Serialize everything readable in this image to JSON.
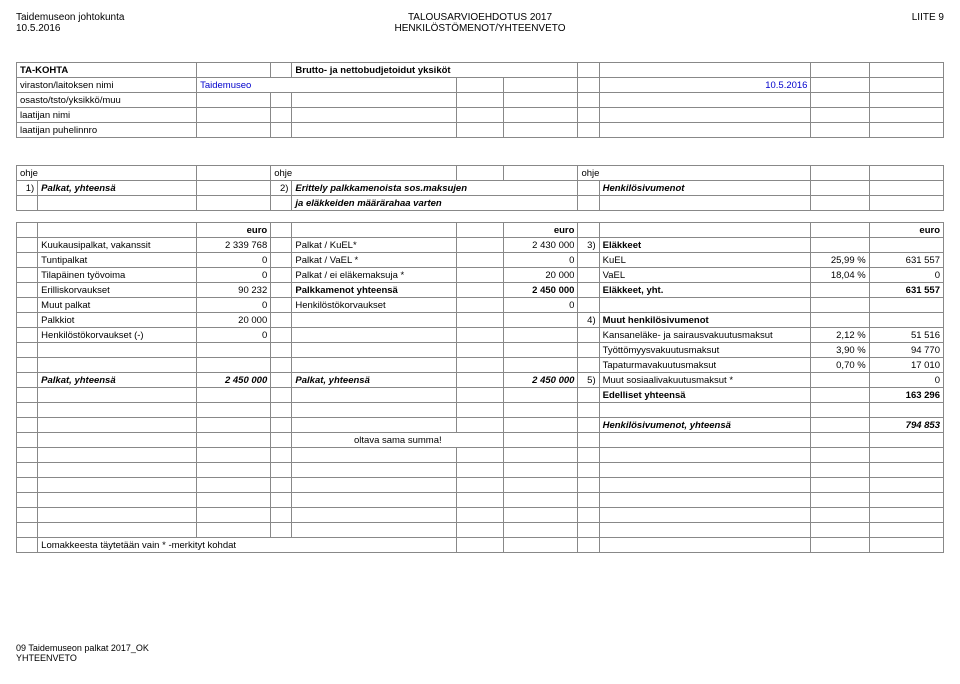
{
  "header": {
    "top_left_1": "Taidemuseon johtokunta",
    "top_left_2": "10.5.2016",
    "top_center_1": "TALOUSARVIOEHDOTUS 2017",
    "top_center_2": "HENKILÖSTÖMENOT/YHTEENVETO",
    "top_right": "LIITE 9"
  },
  "section1": {
    "ta_kohta": "TA-KOHTA",
    "brutto": "Brutto- ja nettobudjetoidut yksiköt",
    "viraston_label": "viraston/laitoksen nimi",
    "viraston_value": "Taidemuseo",
    "date_right": "10.5.2016",
    "osasto": "osasto/tsto/yksikkö/muu",
    "laatijan_nimi": "laatijan nimi",
    "laatijan_puhelin": "laatijan puhelinnro"
  },
  "guide_row": {
    "ohje": "ohje"
  },
  "line": {
    "n1": "1)",
    "palkat_yht": "Palkat, yhteensä",
    "n2": "2)",
    "erittely": "Erittely palkkamenoista sos.maksujen",
    "henkilosivu": "Henkilösivumenot",
    "ja_elak": "ja eläkkeiden määrärahaa varten"
  },
  "euro": "euro",
  "rows_left": {
    "kuukausipalkat": "Kuukausipalkat, vakanssit",
    "kuukausipalkat_v": "2 339 768",
    "tuntipalkat": "Tuntipalkat",
    "tuntipalkat_v": "0",
    "tilapainen": "Tilapäinen työvoima",
    "tilapainen_v": "0",
    "erilliskorvaukset": "Erilliskorvaukset",
    "erilliskorvaukset_v": "90 232",
    "muut_palkat": "Muut palkat",
    "muut_palkat_v": "0",
    "palkkiot": "Palkkiot",
    "palkkiot_v": "20 000",
    "henkilostokorv": "Henkilöstökorvaukset (-)",
    "henkilostokorv_v": "0",
    "palkat_yht": "Palkat, yhteensä",
    "palkat_yht_v": "2 450 000"
  },
  "rows_mid": {
    "palkat_kuel": "Palkat / KuEL*",
    "palkat_kuel_v": "2 430 000",
    "palkat_vael": "Palkat / VaEL *",
    "palkat_vael_v": "0",
    "palkat_ei": "Palkat / ei eläkemaksuja *",
    "palkat_ei_v": "20 000",
    "palkkamenot_yht": "Palkkamenot yhteensä",
    "palkkamenot_yht_v": "2 450 000",
    "henkilostokorv": "Henkilöstökorvaukset",
    "henkilostokorv_v": "0",
    "palkat_yht": "Palkat, yhteensä",
    "palkat_yht_v": "2 450 000",
    "oltava": "oltava sama summa!"
  },
  "rows_right": {
    "n3": "3)",
    "elakkeet": "Eläkkeet",
    "kuel": "KuEL",
    "kuel_p": "25,99 %",
    "kuel_v": "631 557",
    "vael": "VaEL",
    "vael_p": "18,04 %",
    "vael_v": "0",
    "elakkeet_yht": "Eläkkeet, yht.",
    "elakkeet_yht_v": "631 557",
    "n4": "4)",
    "muut_henk": "Muut  henkilösivumenot",
    "kansan": "Kansaneläke- ja sairausvakuutusmaksut",
    "kansan_p": "2,12 %",
    "kansan_v": "51 516",
    "tyott": "Työttömyysvakuutusmaksut",
    "tyott_p": "3,90 %",
    "tyott_v": "94 770",
    "tapa": "Tapaturmavakuutusmaksut",
    "tapa_p": "0,70 %",
    "tapa_v": "17 010",
    "n5": "5)",
    "muut_sos": "Muut sosiaalivakuutusmaksut *",
    "muut_sos_v": "0",
    "edelliset": "Edelliset yhteensä",
    "edelliset_v": "163 296",
    "henk_yht": "Henkilösivumenot, yhteensä",
    "henk_yht_v": "794 853"
  },
  "note": "Lomakkeesta täytetään vain * -merkityt kohdat",
  "footer": {
    "f1": "09 Taidemuseon palkat 2017_OK",
    "f2": "YHTEENVETO"
  }
}
